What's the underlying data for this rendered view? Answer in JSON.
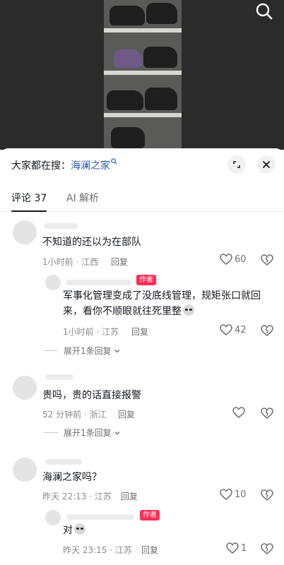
{
  "search_hint": {
    "prefix": "大家都在搜：",
    "keyword": "海澜之家"
  },
  "tabs": [
    {
      "label": "评论 37"
    },
    {
      "label": "AI 解析"
    }
  ],
  "comments": [
    {
      "text": "不知道的还以为在部队",
      "time": "1小时前 · 江西",
      "reply": "回复",
      "likes": "60"
    },
    {
      "badge": "作者",
      "text": "军事化管理变成了没底线管理，规矩张口就回来，看你不顺眼就往死里整",
      "time": "1小时前 · 江苏",
      "reply": "回复",
      "likes": "42",
      "expand": "展开1条回复"
    },
    {
      "text": "贵吗，贵的话直接报警",
      "time": "52 分钟前 · 浙江",
      "reply": "回复",
      "likes": "",
      "expand": "展开1条回复"
    },
    {
      "text": "海澜之家吗？",
      "time": "昨天 22:13 · 江苏",
      "reply": "回复",
      "likes": "10"
    },
    {
      "badge": "作者",
      "text": "对",
      "time": "昨天 23:15 · 江苏",
      "reply": "回复",
      "likes": "1"
    }
  ]
}
